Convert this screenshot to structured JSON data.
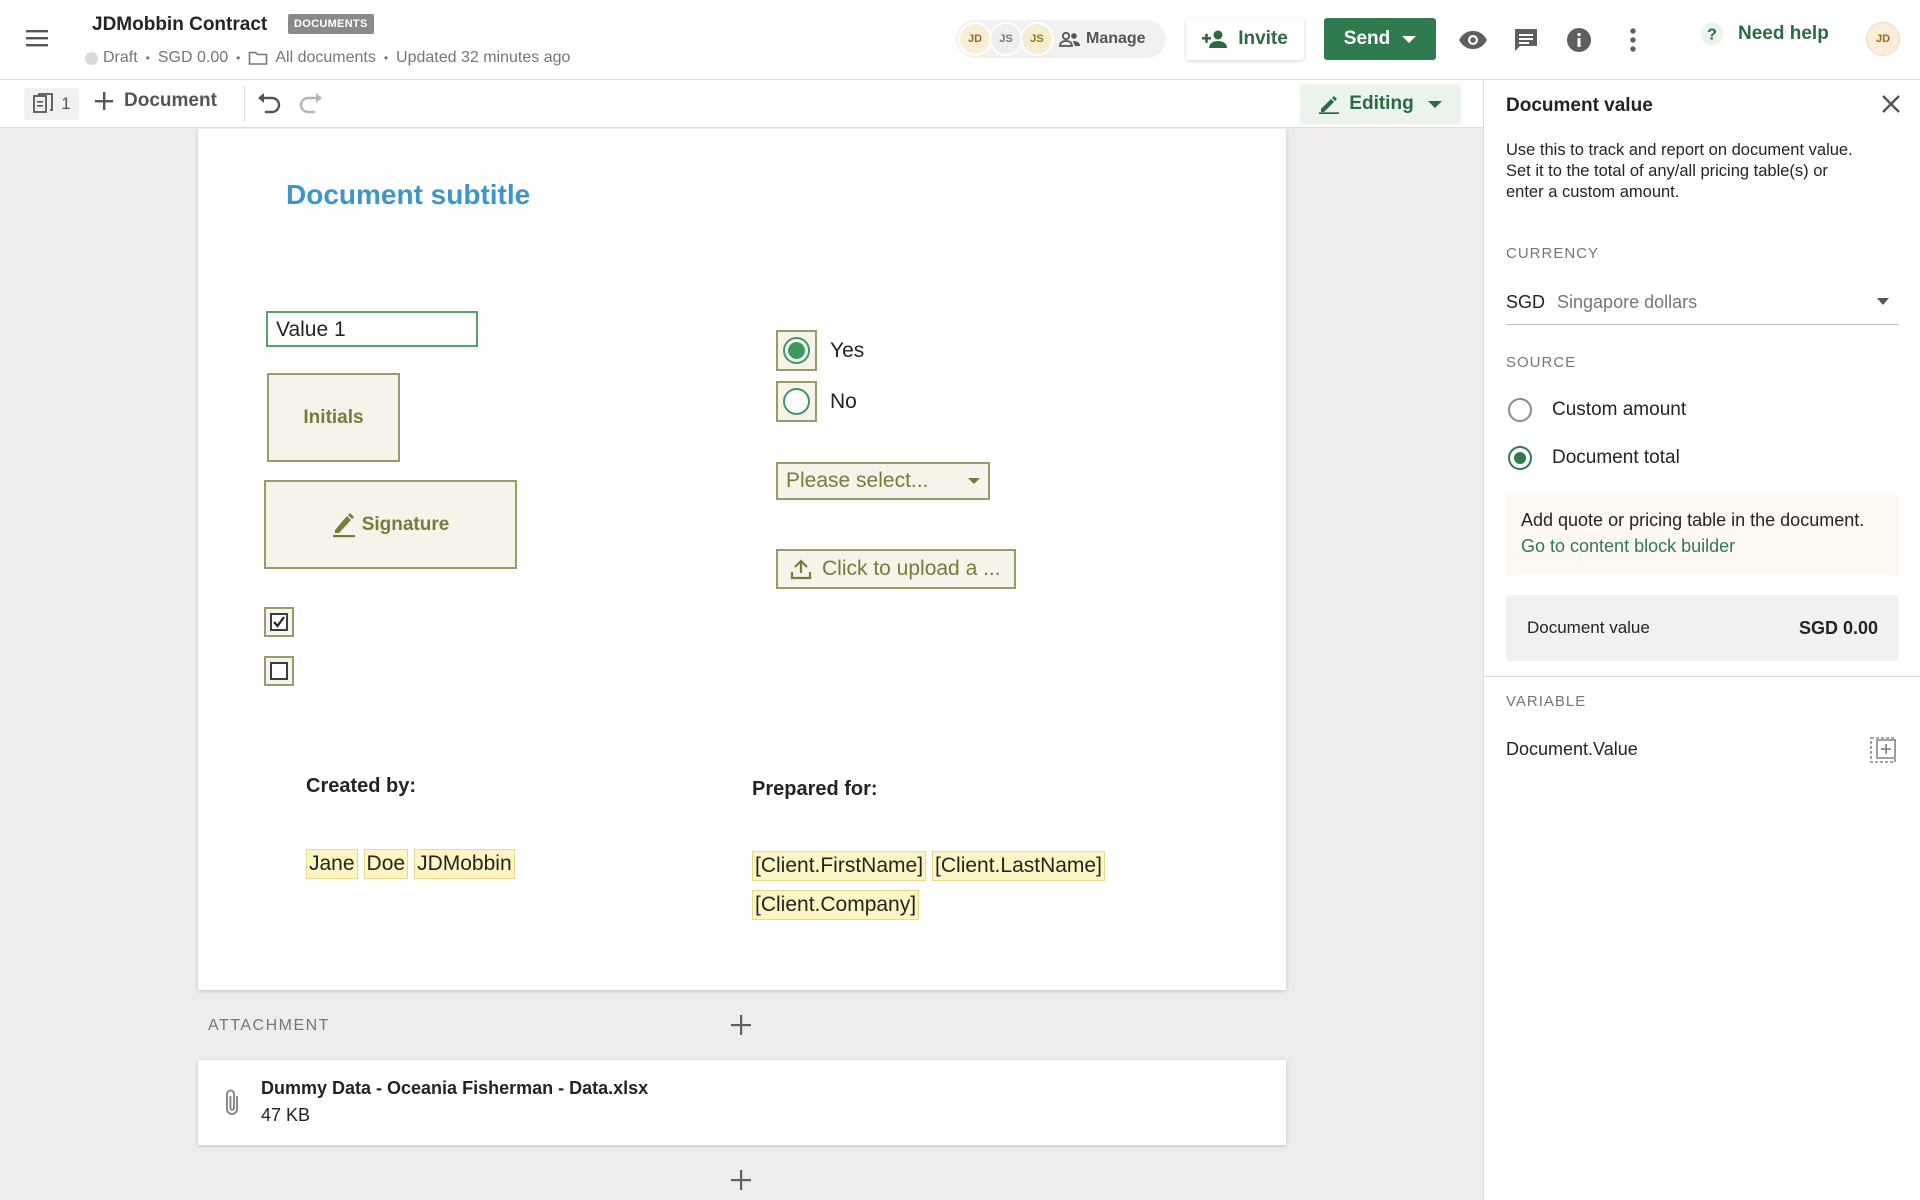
{
  "header": {
    "title": "JDMobbin Contract",
    "badge": "DOCUMENTS",
    "status": "Draft",
    "value": "SGD 0.00",
    "folder": "All documents",
    "updated": "Updated 32 minutes ago",
    "collaborators": [
      "JD",
      "JS",
      "JS"
    ],
    "manage_label": "Manage",
    "invite_label": "Invite",
    "send_label": "Send",
    "help_label": "Need help",
    "user_initials": "JD",
    "accent_color": "#2f7a4e"
  },
  "toolbar": {
    "page_count": "1",
    "add_document_label": "Document",
    "mode_label": "Editing"
  },
  "document": {
    "subtitle": "Document subtitle",
    "text_field_value": "Value 1",
    "initials_label": "Initials",
    "signature_label": "Signature",
    "radio_options": [
      {
        "label": "Yes",
        "selected": true
      },
      {
        "label": "No",
        "selected": false
      }
    ],
    "dropdown_placeholder": "Please select...",
    "upload_label": "Click to upload a ...",
    "checkboxes": [
      true,
      false
    ],
    "created_by_label": "Created by:",
    "prepared_for_label": "Prepared for:",
    "sender_vars": [
      "Jane",
      "Doe",
      "JDMobbin"
    ],
    "client_vars_line1": [
      "[Client.FirstName]",
      "[Client.LastName]"
    ],
    "client_vars_line2": [
      "[Client.Company]"
    ]
  },
  "attachment": {
    "section_label": "ATTACHMENT",
    "file_name": "Dummy Data - Oceania Fisherman - Data.xlsx",
    "file_size": "47 KB"
  },
  "panel": {
    "title": "Document value",
    "description": "Use this to track and report on document value. Set it to the total of any/all pricing table(s) or enter a custom amount.",
    "currency_label": "CURRENCY",
    "currency_code": "SGD",
    "currency_name": "Singapore dollars",
    "source_label": "SOURCE",
    "source_options": [
      {
        "label": "Custom amount",
        "selected": false
      },
      {
        "label": "Document total",
        "selected": true
      }
    ],
    "info_text": "Add quote or pricing table in the document.",
    "info_link": "Go to content block builder",
    "value_label": "Document value",
    "value_amount": "SGD 0.00",
    "variable_label": "VARIABLE",
    "variable_name": "Document.Value"
  }
}
